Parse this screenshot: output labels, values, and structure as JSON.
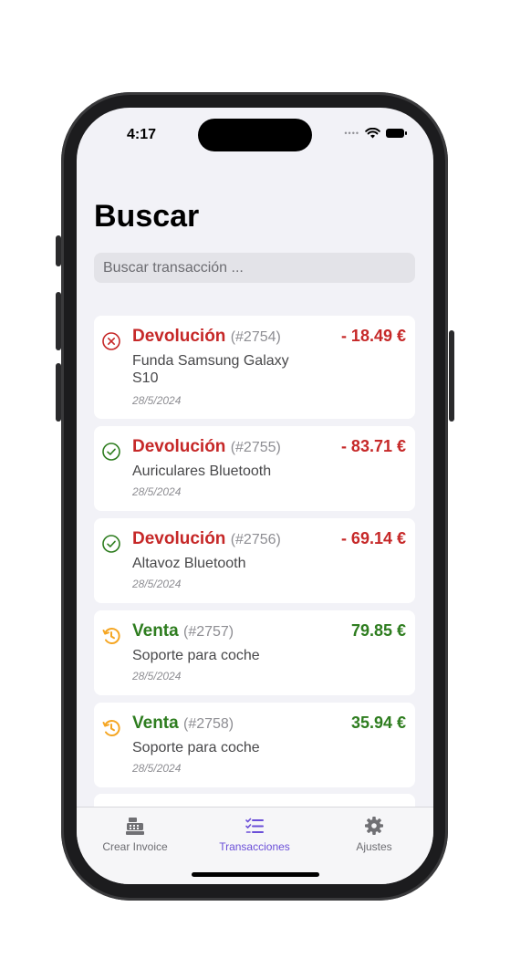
{
  "status_bar": {
    "time": "4:17"
  },
  "header": {
    "title": "Buscar"
  },
  "search": {
    "placeholder": "Buscar transacción ..."
  },
  "transactions": [
    {
      "type": "Devolución",
      "id": "(#2754)",
      "amount": "- 18.49 €",
      "product": "Funda Samsung Galaxy S10",
      "date": "28/5/2024",
      "status_icon": "x-circle-icon",
      "color": "#c62828"
    },
    {
      "type": "Devolución",
      "id": "(#2755)",
      "amount": "- 83.71 €",
      "product": "Auriculares Bluetooth",
      "date": "28/5/2024",
      "status_icon": "check-circle-icon",
      "color": "#c62828"
    },
    {
      "type": "Devolución",
      "id": "(#2756)",
      "amount": "- 69.14 €",
      "product": "Altavoz Bluetooth",
      "date": "28/5/2024",
      "status_icon": "check-circle-icon",
      "color": "#c62828"
    },
    {
      "type": "Venta",
      "id": "(#2757)",
      "amount": "79.85 €",
      "product": "Soporte para coche",
      "date": "28/5/2024",
      "status_icon": "history-icon",
      "color": "#2e7d1f"
    },
    {
      "type": "Venta",
      "id": "(#2758)",
      "amount": "35.94 €",
      "product": "Soporte para coche",
      "date": "28/5/2024",
      "status_icon": "history-icon",
      "color": "#2e7d1f"
    }
  ],
  "tabs": [
    {
      "label": "Crear Invoice",
      "icon": "cash-register-icon"
    },
    {
      "label": "Transacciones",
      "icon": "checklist-icon",
      "active": true
    },
    {
      "label": "Ajustes",
      "icon": "gear-icon"
    }
  ],
  "colors": {
    "accent": "#6b4fd8",
    "refund": "#c62828",
    "sale": "#2e7d1f",
    "pending": "#f5a623"
  }
}
